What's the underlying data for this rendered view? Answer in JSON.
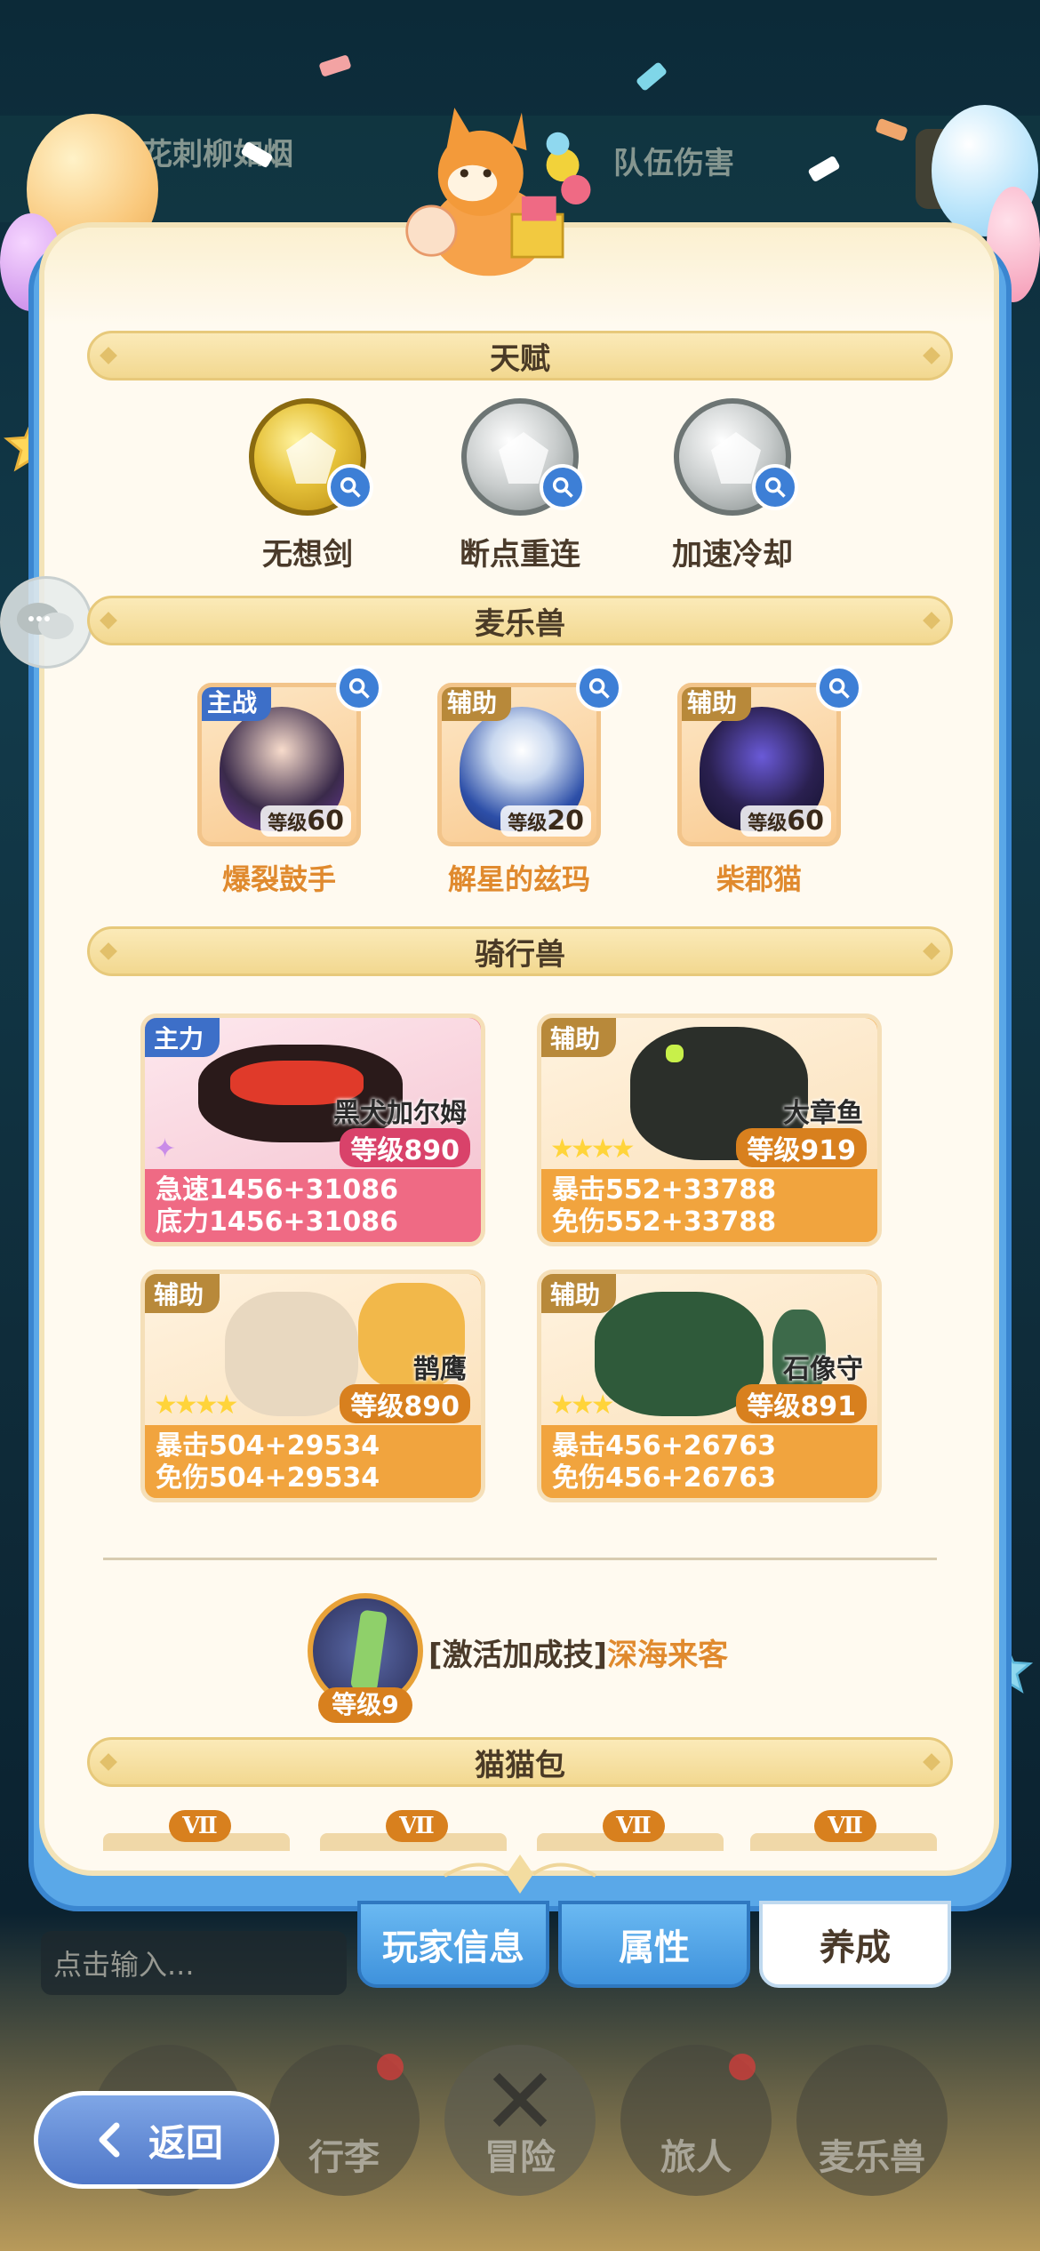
{
  "colors": {
    "panel_bg": "#fffaf0",
    "accent_orange": "#e08a2e",
    "tab_blue": "#3f92dc",
    "mount_pink": "#ef6a84",
    "mount_orange": "#f1a43e"
  },
  "background": {
    "top_left_text": "花刺柳如烟",
    "top_right_text": "队伍伤害"
  },
  "sections": {
    "talent": "天赋",
    "pets": "麦乐兽",
    "mounts": "骑行兽",
    "bag": "猫猫包"
  },
  "talents": [
    {
      "name": "无想剑",
      "tier": "gold",
      "icon": "sword-emblem-icon"
    },
    {
      "name": "断点重连",
      "tier": "silver",
      "icon": "shield-emblem-icon"
    },
    {
      "name": "加速冷却",
      "tier": "silver",
      "icon": "wing-emblem-icon"
    }
  ],
  "pets": [
    {
      "role": "主战",
      "level_prefix": "等级",
      "level": "60",
      "name": "爆裂鼓手"
    },
    {
      "role": "辅助",
      "level_prefix": "等级",
      "level": "20",
      "name": "解星的兹玛"
    },
    {
      "role": "辅助",
      "level_prefix": "等级",
      "level": "60",
      "name": "柴郡猫"
    }
  ],
  "mounts": [
    {
      "role": "主力",
      "name": "黑犬加尔姆",
      "level": "等级890",
      "stat1": "急速1456+31086",
      "stat2": "底力1456+31086",
      "stars": "✦"
    },
    {
      "role": "辅助",
      "name": "大章鱼",
      "level": "等级919",
      "stat1": "暴击552+33788",
      "stat2": "免伤552+33788",
      "stars": "★★★★"
    },
    {
      "role": "辅助",
      "name": "鹊鹰",
      "level": "等级890",
      "stat1": "暴击504+29534",
      "stat2": "免伤504+29534",
      "stars": "★★★★"
    },
    {
      "role": "辅助",
      "name": "石像守",
      "level": "等级891",
      "stat1": "暴击456+26763",
      "stat2": "免伤456+26763",
      "stars": "★★★"
    }
  ],
  "bonus_skill": {
    "prefix": "[激活加成技]",
    "name": "深海来客",
    "level": "等级9"
  },
  "bag_tags": [
    "Ⅶ",
    "Ⅶ",
    "Ⅶ",
    "Ⅶ"
  ],
  "tabs": {
    "player_info": "玩家信息",
    "attributes": "属性",
    "develop": "养成",
    "active": "养成"
  },
  "chat": {
    "placeholder": "点击输入..."
  },
  "nav": {
    "items": [
      "行李",
      "冒险",
      "旅人",
      "麦乐兽"
    ],
    "back": "返回"
  }
}
